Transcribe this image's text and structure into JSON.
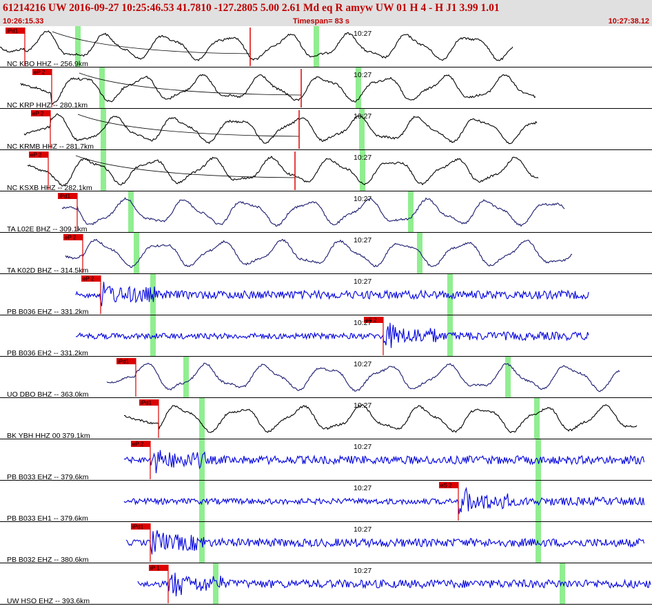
{
  "header": {
    "title": "61214216 UW 2016-09-27 10:25:46.53   41.7810 -127.2805   5.00  2.61 Md   eq   R amyw     UW 01  H   4  -  H J1     3.99  1.01",
    "start_time": "10:26:15.33",
    "timespan": "Timespan=  83 s",
    "end_time": "10:27:38.12"
  },
  "colors": {
    "header_bg": "#e0e0e0",
    "header_text": "#c00000",
    "pick": "#dd0000",
    "window": "#90ee90",
    "trace_black": "#000000",
    "trace_navy": "#1a1a6e",
    "trace_blue": "#0000dd"
  },
  "tick_label": "10:27",
  "channels": [
    {
      "label": "NC KBO HHZ -- 256.9km",
      "picks": [
        "iPd1"
      ],
      "color": "black"
    },
    {
      "label": "NC KRP HHZ -- 280.1km",
      "picks": [
        "eP 2"
      ],
      "color": "black"
    },
    {
      "label": "NC KRMB HHZ -- 281.7km",
      "picks": [
        "eP 2"
      ],
      "color": "black"
    },
    {
      "label": "NC KSXB HHZ -- 282.1km",
      "picks": [
        "eP 2"
      ],
      "color": "black"
    },
    {
      "label": "TA L02E BHZ -- 309.1km",
      "picks": [
        "iPd1"
      ],
      "color": "navy"
    },
    {
      "label": "TA K02D BHZ -- 314.5km",
      "picks": [
        "eP 2"
      ],
      "color": "navy"
    },
    {
      "label": "PB B036 EHZ -- 331.2km",
      "picks": [
        "eP 2"
      ],
      "color": "blue"
    },
    {
      "label": "PB B036 EH2 -- 331.2km",
      "picks": [
        "eS 2"
      ],
      "color": "blue"
    },
    {
      "label": "UO DBO BHZ -- 363.0km",
      "picks": [
        "iPd1"
      ],
      "color": "navy"
    },
    {
      "label": "BK YBH HHZ 00 379.1km",
      "picks": [
        "iPd1"
      ],
      "color": "black"
    },
    {
      "label": "PB B033 EHZ -- 379.6km",
      "picks": [
        "eP 2"
      ],
      "color": "blue"
    },
    {
      "label": "PB B033 EH1 -- 379.6km",
      "picks": [
        "eS 2"
      ],
      "color": "blue"
    },
    {
      "label": "PB B032 EHZ -- 380.6km",
      "picks": [
        "iPd1"
      ],
      "color": "blue"
    },
    {
      "label": "UW HSO EHZ -- 393.6km",
      "picks": [
        "iP 1"
      ],
      "color": "blue"
    }
  ]
}
